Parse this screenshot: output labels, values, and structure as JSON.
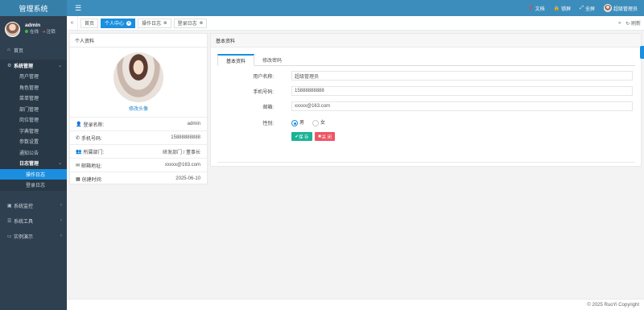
{
  "app": {
    "title": "管理系统"
  },
  "user": {
    "name": "admin",
    "status_online": "在线",
    "logout": "注销"
  },
  "sidebar": {
    "home": "首页",
    "system_mgmt": "系统管理",
    "system_items": [
      "用户管理",
      "角色管理",
      "菜单管理",
      "部门管理",
      "岗位管理",
      "字典管理",
      "参数设置",
      "通知公告"
    ],
    "log_mgmt": "日志管理",
    "log_items": [
      "操作日志",
      "登录日志"
    ],
    "monitor": "系统监控",
    "tools": "系统工具",
    "demo": "实例演示"
  },
  "topbar": {
    "doc": "文档",
    "lock": "锁屏",
    "fullscreen": "全屏",
    "user_label": "超级管理员"
  },
  "tabs": {
    "items": [
      {
        "label": "首页",
        "active": false,
        "closable": false
      },
      {
        "label": "个人中心",
        "active": true,
        "closable": true
      },
      {
        "label": "操作日志",
        "active": false,
        "closable": true
      },
      {
        "label": "登录日志",
        "active": false,
        "closable": true
      }
    ],
    "refresh": "刷新"
  },
  "profile": {
    "card_title": "个人资料",
    "change_avatar": "修改头像",
    "rows": [
      {
        "label": "登录名称:",
        "value": "admin",
        "icon": "user-icon"
      },
      {
        "label": "手机号码:",
        "value": "15888888888",
        "icon": "phone-icon"
      },
      {
        "label": "所属部门:",
        "value": "研发部门 / 董事长",
        "icon": "group-icon"
      },
      {
        "label": "邮箱地址:",
        "value": "xxxxx@163.com",
        "icon": "envelope-icon"
      },
      {
        "label": "创建时间:",
        "value": "2025-06-10",
        "icon": "calendar-icon"
      }
    ]
  },
  "basic": {
    "card_title": "基本资料",
    "tab_basic": "基本资料",
    "tab_password": "修改密码",
    "name_label": "用户名称:",
    "name_value": "超级管理员",
    "phone_label": "手机号码:",
    "phone_value": "15888888888",
    "email_label": "邮箱:",
    "email_value": "xxxxx@163.com",
    "gender_label": "性别:",
    "male": "男",
    "female": "女",
    "save": "保 存",
    "close": "关 闭"
  },
  "footer": {
    "copyright": "© 2025 RuoYi Copyright"
  },
  "colors": {
    "sidebar": "#2f4050",
    "header": "#3c8dbc",
    "accent": "#1a8fe0",
    "save": "#1ab394",
    "close": "#ed5565"
  }
}
